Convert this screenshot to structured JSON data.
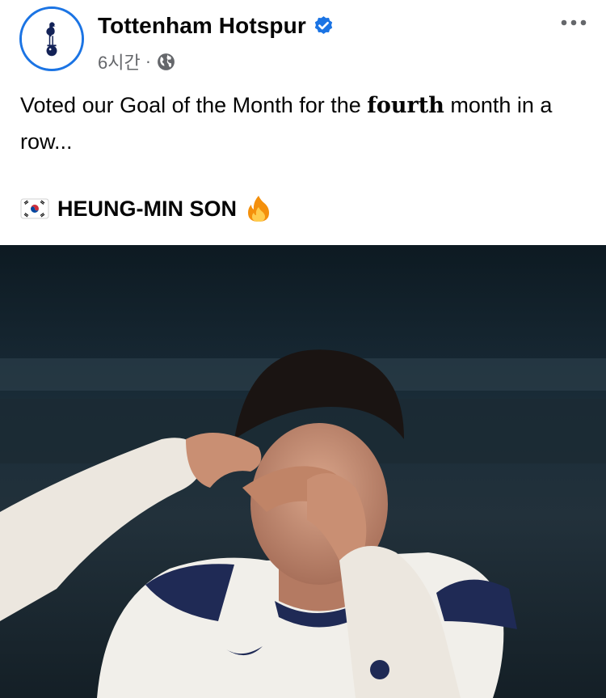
{
  "post": {
    "page_name": "Tottenham Hotspur",
    "timestamp": "6시간",
    "separator": "·",
    "text_before": "Voted our Goal of the Month for the ",
    "text_emphasis": "fourth",
    "text_after": " month in a row...",
    "highlight_name": "HEUNG-MIN SON",
    "icons": {
      "avatar": "tottenham-crest-icon",
      "verified": "verified-badge-icon",
      "audience": "globe-icon",
      "more": "more-options-icon",
      "flag": "south-korea-flag-icon",
      "emoji": "fire-icon"
    },
    "colors": {
      "accent": "#1b74e4",
      "meta_text": "#65676b",
      "body_text": "#050505"
    }
  }
}
